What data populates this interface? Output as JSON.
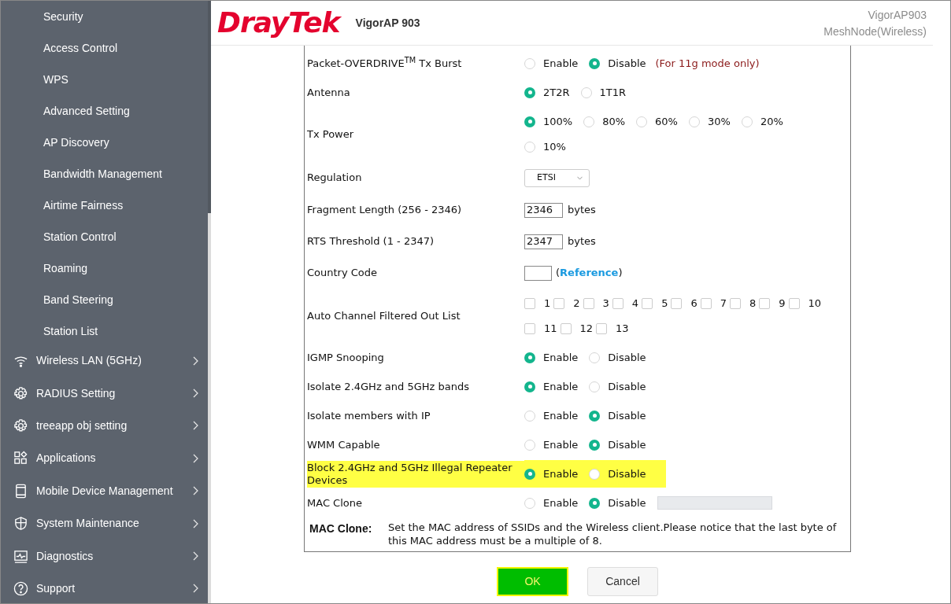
{
  "sidebar": {
    "sub_items": [
      "Security",
      "Access Control",
      "WPS",
      "Advanced Setting",
      "AP Discovery",
      "Bandwidth Management",
      "Airtime Fairness",
      "Station Control",
      "Roaming",
      "Band Steering",
      "Station List"
    ],
    "menu": [
      {
        "label": "Wireless LAN (5GHz)",
        "kind": "wifi"
      },
      {
        "label": "RADIUS Setting",
        "kind": "gear"
      },
      {
        "label": "treeapp obj setting",
        "kind": "gear"
      },
      {
        "label": "Applications",
        "kind": "apps"
      },
      {
        "label": "Mobile Device Management",
        "kind": "mobile"
      },
      {
        "label": "System Maintenance",
        "kind": "shield"
      },
      {
        "label": "Diagnostics",
        "kind": "monitor"
      },
      {
        "label": "Support",
        "kind": "help"
      }
    ]
  },
  "header": {
    "logo": "DrayTek",
    "model": "VigorAP 903",
    "device_name": "VigorAP903",
    "mode": "MeshNode(Wireless)"
  },
  "settings": [
    {
      "kind": "radio",
      "label": "Packet-OVERDRIVE$^{TM}$ Tx Burst",
      "options": [
        {
          "label": "Enable",
          "selected": false
        },
        {
          "label": "Disable",
          "selected": true
        }
      ],
      "note": "(For 11g mode only)"
    },
    {
      "kind": "radio",
      "label": "Antenna",
      "options": [
        {
          "label": "2T2R",
          "selected": true
        },
        {
          "label": "1T1R",
          "selected": false
        }
      ]
    },
    {
      "kind": "radio",
      "label": "Tx Power",
      "options": [
        {
          "label": "100%",
          "selected": true
        },
        {
          "label": "80%",
          "selected": false
        },
        {
          "label": "60%",
          "selected": false
        },
        {
          "label": "30%",
          "selected": false
        },
        {
          "label": "20%",
          "selected": false
        },
        {
          "label": "10%",
          "selected": false
        }
      ]
    },
    {
      "kind": "select",
      "label": "Regulation",
      "value": "ETSI"
    },
    {
      "kind": "input",
      "label": "Fragment Length (256 - 2346)",
      "value": "2346",
      "unit": "bytes"
    },
    {
      "kind": "input",
      "label": "RTS Threshold (1 - 2347)",
      "value": "2347",
      "unit": "bytes"
    },
    {
      "kind": "link",
      "label": "Country Code",
      "link": "(**Reference**)"
    },
    {
      "kind": "checkboxes",
      "label": "Auto Channel Filtered Out List",
      "options": [
        {
          "label": "1",
          "checked": false
        },
        {
          "label": "2",
          "checked": false
        },
        {
          "label": "3",
          "checked": false
        },
        {
          "label": "4",
          "checked": false
        },
        {
          "label": "5",
          "checked": false
        },
        {
          "label": "6",
          "checked": false
        },
        {
          "label": "7",
          "checked": false
        },
        {
          "label": "8",
          "checked": false
        },
        {
          "label": "9",
          "checked": false
        },
        {
          "label": "10",
          "checked": false
        },
        {
          "label": "11",
          "checked": false
        },
        {
          "label": "12",
          "checked": false
        },
        {
          "label": "13",
          "checked": false
        }
      ]
    },
    {
      "kind": "radio",
      "label": "IGMP Snooping",
      "options": [
        {
          "label": "Enable",
          "selected": true
        },
        {
          "label": "Disable",
          "selected": false
        }
      ]
    },
    {
      "kind": "radio",
      "label": "Isolate 2.4GHz and 5GHz bands",
      "options": [
        {
          "label": "Enable",
          "selected": true
        },
        {
          "label": "Disable",
          "selected": false
        }
      ]
    },
    {
      "kind": "radio",
      "label": "Isolate members with IP",
      "options": [
        {
          "label": "Enable",
          "selected": false
        },
        {
          "label": "Disable",
          "selected": true
        }
      ]
    },
    {
      "kind": "radio",
      "label": "WMM Capable",
      "options": [
        {
          "label": "Enable",
          "selected": false
        },
        {
          "label": "Disable",
          "selected": true
        }
      ]
    },
    {
      "kind": "radio",
      "label": "Block 2.4GHz and 5GHz Illegal Repeater Devices",
      "highlighted": true,
      "options": [
        {
          "label": "Enable",
          "selected": true
        },
        {
          "label": "Disable",
          "selected": false
        }
      ]
    },
    {
      "kind": "radio",
      "label": "MAC Clone",
      "options": [
        {
          "label": "Enable",
          "selected": false
        },
        {
          "label": "Disable",
          "selected": true
        }
      ],
      "field": {
        "disabled": true
      }
    }
  ],
  "help": {
    "term": "MAC Clone:",
    "text": "Set the MAC address of SSIDs and the Wireless client.Please notice that the last byte of this MAC address must be a multiple of 8."
  },
  "buttons": [
    {
      "label": "OK",
      "kind": "primary"
    },
    {
      "label": "Cancel",
      "kind": "secondary"
    }
  ]
}
